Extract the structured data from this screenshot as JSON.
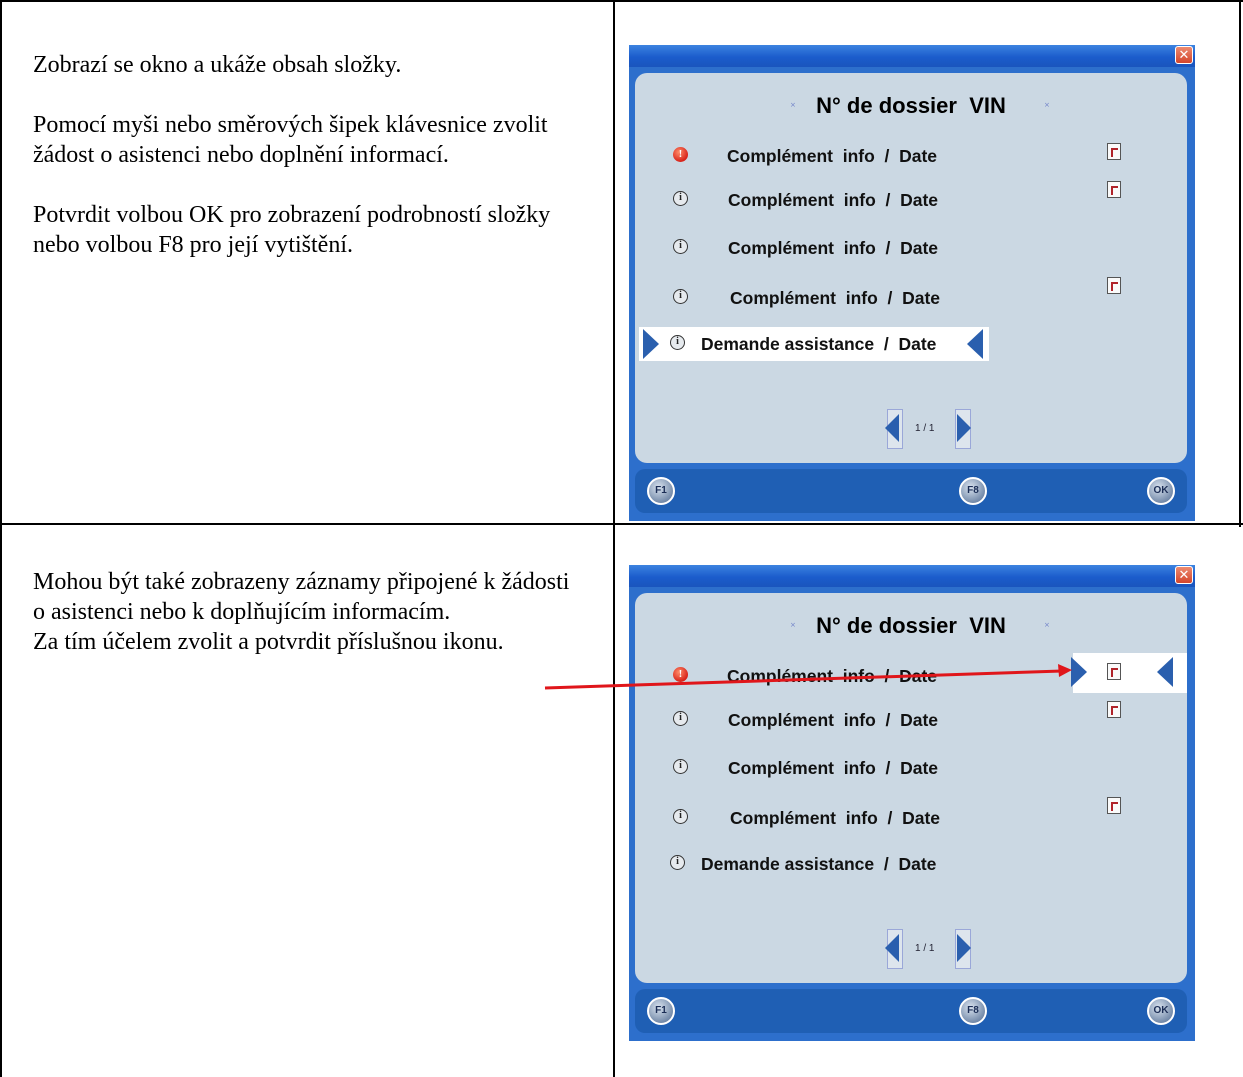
{
  "rows": [
    {
      "description": [
        "Zobrazí se okno a ukáže obsah složky.",
        "Pomocí myši nebo směrových šipek klávesnice zvolit žádost o asistenci nebo doplnění informací.",
        "Potvrdit volbou OK pro zobrazení podrobností složky nebo volbou F8 pro její vytištění."
      ]
    },
    {
      "description": [
        "Mohou být také zobrazeny záznamy připojené  k žádosti o asistenci nebo k doplňujícím informacím.",
        "Za tím účelem zvolit a potvrdit příslušnou ikonu."
      ]
    }
  ],
  "screen": {
    "title": "N° de dossier  VIN",
    "close_icon": "close-icon",
    "items": [
      {
        "label": "Complément  info  /  Date",
        "status_icon": "warning-icon",
        "attachment": true
      },
      {
        "label": "Complément  info  /  Date",
        "status_icon": "info-icon",
        "attachment": true
      },
      {
        "label": "Complément  info  /  Date",
        "status_icon": "info-icon",
        "attachment": false
      },
      {
        "label": "Complément  info  /  Date",
        "status_icon": "info-icon",
        "attachment": true
      },
      {
        "label": "Demande assistance  /  Date",
        "status_icon": "info-icon",
        "attachment": false
      }
    ],
    "pager": "1 / 1",
    "buttons": {
      "back": "F1",
      "print": "F8",
      "ok": "OK"
    }
  },
  "colors": {
    "titlebar": "#1b5ccc",
    "panel": "#cbd8e3",
    "bottom_bar": "#1f5fb4",
    "selection_arrow": "#2a5fae",
    "annotation_arrow": "#e0161b"
  }
}
